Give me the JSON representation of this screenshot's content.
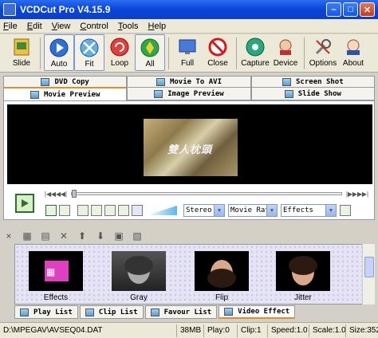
{
  "window": {
    "title": "VCDCut Pro V4.15.9"
  },
  "menu": [
    "File",
    "Edit",
    "View",
    "Control",
    "Tools",
    "Help"
  ],
  "toolbar": [
    {
      "label": "Slide",
      "icon": "slide-icon"
    },
    {
      "label": "Auto",
      "icon": "auto-icon"
    },
    {
      "label": "Fit",
      "icon": "fit-icon"
    },
    {
      "label": "Loop",
      "icon": "loop-icon"
    },
    {
      "label": "All",
      "icon": "all-icon"
    },
    {
      "label": "Full",
      "icon": "full-screen-icon"
    },
    {
      "label": "Close",
      "icon": "close-file-icon"
    },
    {
      "label": "Capture",
      "icon": "capture-icon"
    },
    {
      "label": "Device",
      "icon": "device-icon"
    },
    {
      "label": "Options",
      "icon": "options-icon"
    },
    {
      "label": "About",
      "icon": "about-icon"
    }
  ],
  "tabs_top": [
    "DVD Copy",
    "Movie To AVI",
    "Screen Shot"
  ],
  "tabs_mid": [
    "Movie Preview",
    "Image Preview",
    "Slide Show"
  ],
  "preview": {
    "overlay_text": "雙人枕頭"
  },
  "selects": {
    "audio": "Stereo",
    "rate": "Movie Rat",
    "effects": "Effects"
  },
  "thumbnails": [
    {
      "label": "Effects"
    },
    {
      "label": "Gray"
    },
    {
      "label": "Flip"
    },
    {
      "label": "Jitter"
    }
  ],
  "tabs_bottom": [
    "Play List",
    "Clip List",
    "Favour List",
    "Video Effect"
  ],
  "status": {
    "path": "D:\\MPEGAV\\AVSEQ04.DAT",
    "size": "38MB",
    "play": "Play:0",
    "clip": "Clip:1",
    "speed": "Speed:1.0",
    "scale": "Scale:1.0",
    "size2": "Size:352"
  },
  "colors": {
    "title_bar": "#0a45d8",
    "accent_tab": "#e68b2c"
  }
}
